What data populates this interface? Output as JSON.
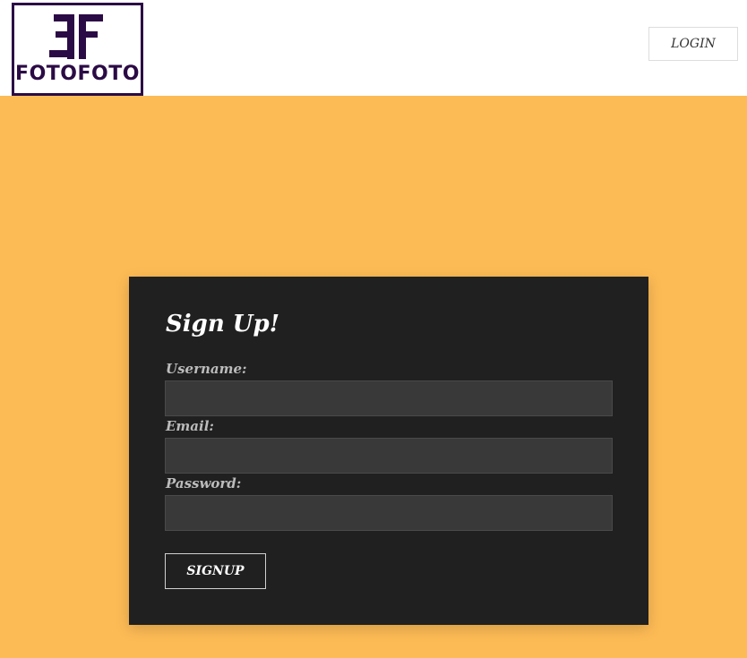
{
  "brand": {
    "logo_text": "FOTOFOTO",
    "logo_color": "#2b0b45",
    "logo_icon": "ff-monogram-icon"
  },
  "header": {
    "login_label": "LOGIN"
  },
  "colors": {
    "page_background": "#fdbb55",
    "card_background": "#202020",
    "input_background": "#393939"
  },
  "signup_form": {
    "title": "Sign Up!",
    "fields": [
      {
        "label": "Username:",
        "value": "",
        "placeholder": ""
      },
      {
        "label": "Email:",
        "value": "",
        "placeholder": ""
      },
      {
        "label": "Password:",
        "value": "",
        "placeholder": ""
      }
    ],
    "submit_label": "SIGNUP"
  }
}
